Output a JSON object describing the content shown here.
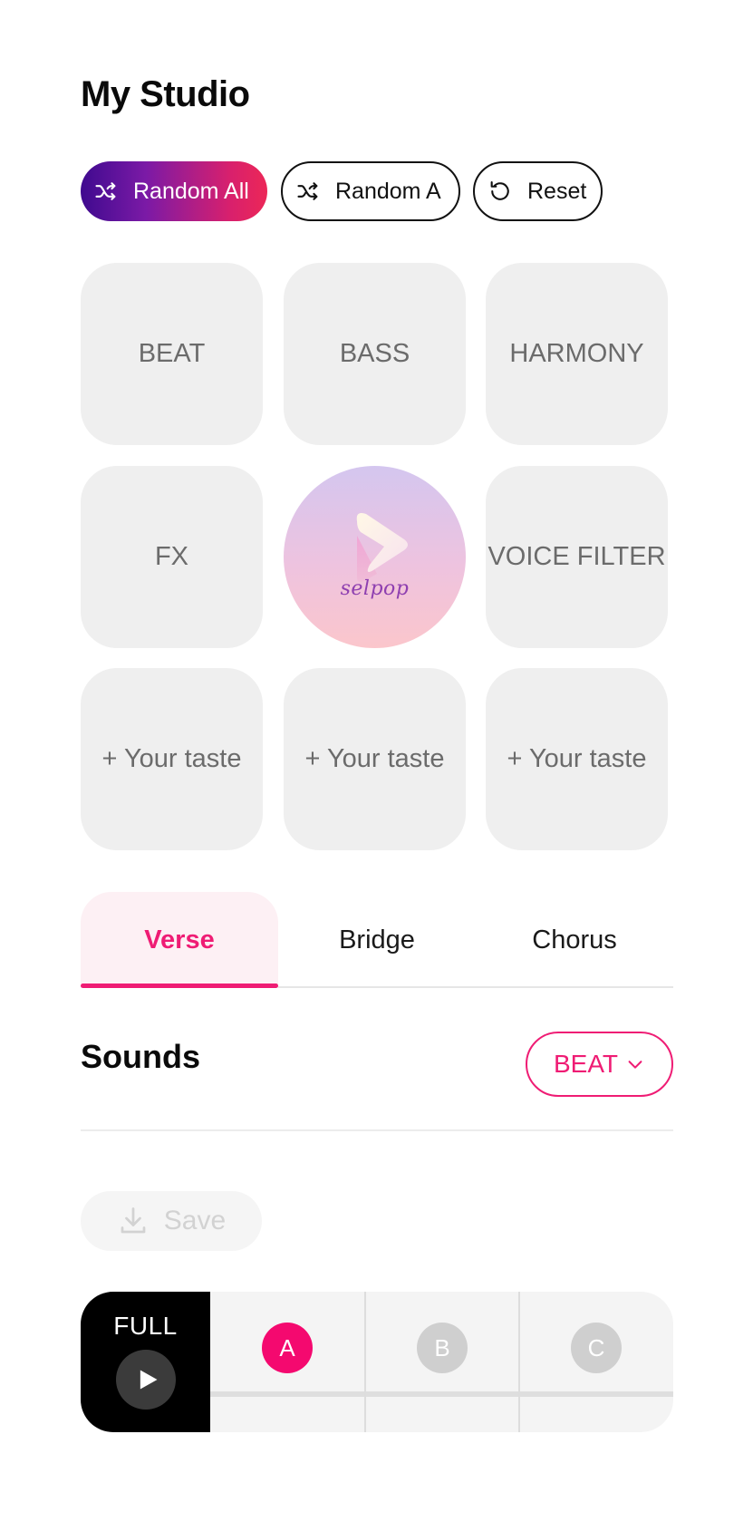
{
  "header": {
    "title": "My Studio"
  },
  "actions": {
    "random_all": "Random All",
    "random_a": "Random A",
    "reset": "Reset"
  },
  "grid": {
    "beat": "BEAT",
    "bass": "BASS",
    "harmony": "HARMONY",
    "fx": "FX",
    "voice_filter": "VOICE FILTER",
    "logo_text": "selpop",
    "custom_1": "+ Your taste",
    "custom_2": "+ Your taste",
    "custom_3": "+ Your taste"
  },
  "tabs": [
    {
      "label": "Verse",
      "active": true
    },
    {
      "label": "Bridge",
      "active": false
    },
    {
      "label": "Chorus",
      "active": false
    }
  ],
  "sounds": {
    "title": "Sounds",
    "dropdown_value": "BEAT"
  },
  "save": {
    "label": "Save"
  },
  "player": {
    "full_label": "FULL",
    "segments": [
      {
        "label": "A",
        "active": true
      },
      {
        "label": "B",
        "active": false
      },
      {
        "label": "C",
        "active": false
      }
    ]
  },
  "colors": {
    "accent": "#ef1c74",
    "gradient_start": "#3f0a8f",
    "gradient_end": "#ec2757",
    "tile_bg": "#efefef"
  }
}
